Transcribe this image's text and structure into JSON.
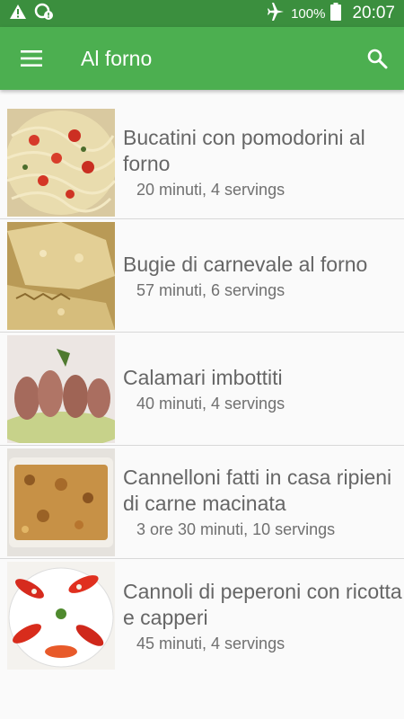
{
  "status_bar": {
    "battery_label": "100%",
    "time": "20:07",
    "icons": [
      "warning-icon",
      "sync-alert-icon",
      "airplane-icon",
      "battery-icon"
    ]
  },
  "app_bar": {
    "title": "Al forno",
    "menu_icon": "hamburger-menu-icon",
    "search_icon": "search-icon",
    "color": "#4caf50",
    "status_color": "#3b8f3e"
  },
  "recipes": [
    {
      "name": "Bucatini con pomodorini al forno",
      "meta": "20 minuti, 4 servings"
    },
    {
      "name": "Bugie di carnevale al forno",
      "meta": "57 minuti, 6 servings"
    },
    {
      "name": "Calamari imbottiti",
      "meta": "40 minuti, 4 servings"
    },
    {
      "name": "Cannelloni fatti in casa ripieni di carne macinata",
      "meta": "3 ore 30 minuti, 10 servings"
    },
    {
      "name": "Cannoli di peperoni con ricotta e capperi",
      "meta": "45 minuti, 4 servings"
    }
  ]
}
